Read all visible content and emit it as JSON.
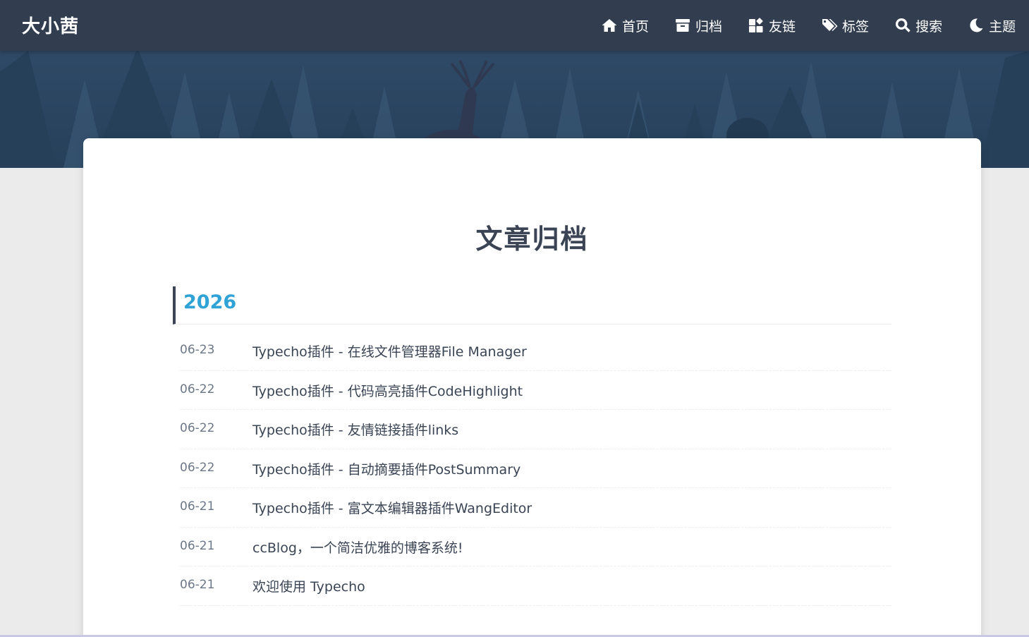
{
  "site": {
    "brand": "大小茜"
  },
  "nav": {
    "items": [
      {
        "label": "首页",
        "icon": "home-icon"
      },
      {
        "label": "归档",
        "icon": "archive-icon"
      },
      {
        "label": "友链",
        "icon": "widgets-icon"
      },
      {
        "label": "标签",
        "icon": "tags-icon"
      },
      {
        "label": "搜索",
        "icon": "search-icon"
      },
      {
        "label": "主题",
        "icon": "moon-icon"
      }
    ]
  },
  "archive": {
    "title": "文章归档",
    "year": "2026",
    "posts": [
      {
        "date": "06-23",
        "title": "Typecho插件 - 在线文件管理器File Manager"
      },
      {
        "date": "06-22",
        "title": "Typecho插件 - 代码高亮插件CodeHighlight"
      },
      {
        "date": "06-22",
        "title": "Typecho插件 - 友情链接插件links"
      },
      {
        "date": "06-22",
        "title": "Typecho插件 - 自动摘要插件PostSummary"
      },
      {
        "date": "06-21",
        "title": "Typecho插件 - 富文本编辑器插件WangEditor"
      },
      {
        "date": "06-21",
        "title": "ccBlog，一个简洁优雅的博客系统!"
      },
      {
        "date": "06-21",
        "title": "欢迎使用 Typecho"
      }
    ]
  },
  "colors": {
    "header": "#323e50",
    "accent": "#2fa3d6",
    "text": "#3a4454"
  }
}
